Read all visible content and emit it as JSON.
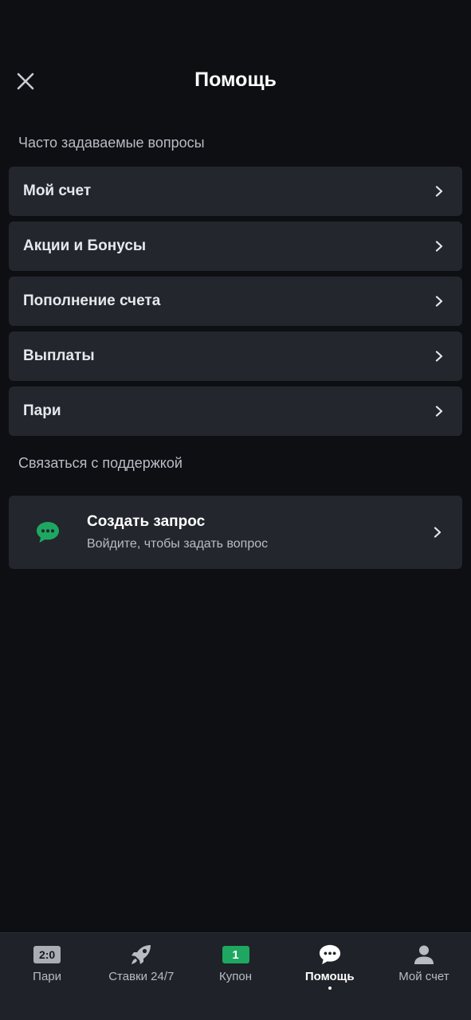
{
  "header": {
    "title": "Помощь",
    "close_icon": "close-icon"
  },
  "faq": {
    "section_label": "Часто задаваемые вопросы",
    "items": [
      {
        "label": "Мой счет"
      },
      {
        "label": "Акции и Бонусы"
      },
      {
        "label": "Пополнение счета"
      },
      {
        "label": "Выплаты"
      },
      {
        "label": "Пари"
      }
    ]
  },
  "support": {
    "section_label": "Связаться с поддержкой",
    "title": "Создать запрос",
    "subtitle": "Войдите, чтобы задать вопрос",
    "icon": "chat-bubble-icon",
    "icon_color": "#1ea760"
  },
  "bottom_nav": {
    "items": [
      {
        "label": "Пари",
        "icon": "score-icon",
        "badge": "2:0"
      },
      {
        "label": "Ставки 24/7",
        "icon": "rocket-icon"
      },
      {
        "label": "Купон",
        "icon": "coupon-icon",
        "badge": "1"
      },
      {
        "label": "Помощь",
        "icon": "chat-bubble-icon",
        "active": true
      },
      {
        "label": "Мой счет",
        "icon": "user-icon"
      }
    ]
  },
  "colors": {
    "background": "#0d0f12",
    "card": "#23262d",
    "accent_green": "#1ea760",
    "muted_text": "#b8bcc4"
  }
}
